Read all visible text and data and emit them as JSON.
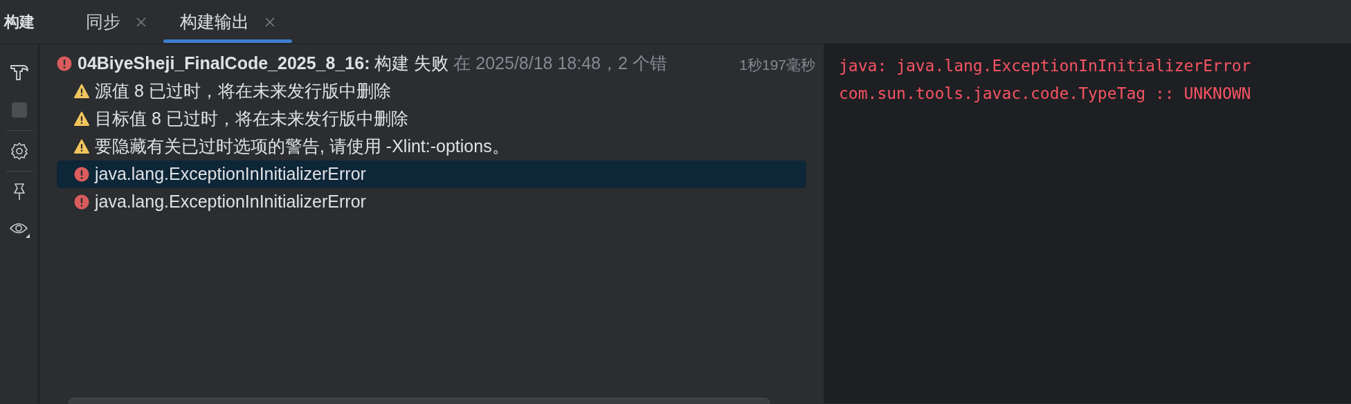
{
  "tool_window": {
    "title": "构建"
  },
  "tabs": [
    {
      "label": "同步",
      "selected": false,
      "closable": true
    },
    {
      "label": "构建输出",
      "selected": true,
      "closable": true
    }
  ],
  "build_tree": {
    "kind": "error",
    "project": "04BiyeSheji_FinalCode_2025_8_16:",
    "result": "构建 失败",
    "details": "在 2025/8/18 18:48，2 个错",
    "duration": "1秒197毫秒",
    "children": [
      {
        "kind": "warning",
        "text": "源值 8 已过时，将在未来发行版中删除",
        "selected": false
      },
      {
        "kind": "warning",
        "text": "目标值 8 已过时，将在未来发行版中删除",
        "selected": false
      },
      {
        "kind": "warning",
        "text": "要隐藏有关已过时选项的警告, 请使用 -Xlint:-options。",
        "selected": false
      },
      {
        "kind": "error",
        "text": "java.lang.ExceptionInInitializerError",
        "selected": true
      },
      {
        "kind": "error",
        "text": "java.lang.ExceptionInInitializerError",
        "selected": false
      }
    ]
  },
  "output": {
    "lines": [
      {
        "text": "java: java.lang.ExceptionInInitializerError"
      },
      {
        "text": "com.sun.tools.javac.code.TypeTag :: UNKNOWN"
      }
    ]
  }
}
